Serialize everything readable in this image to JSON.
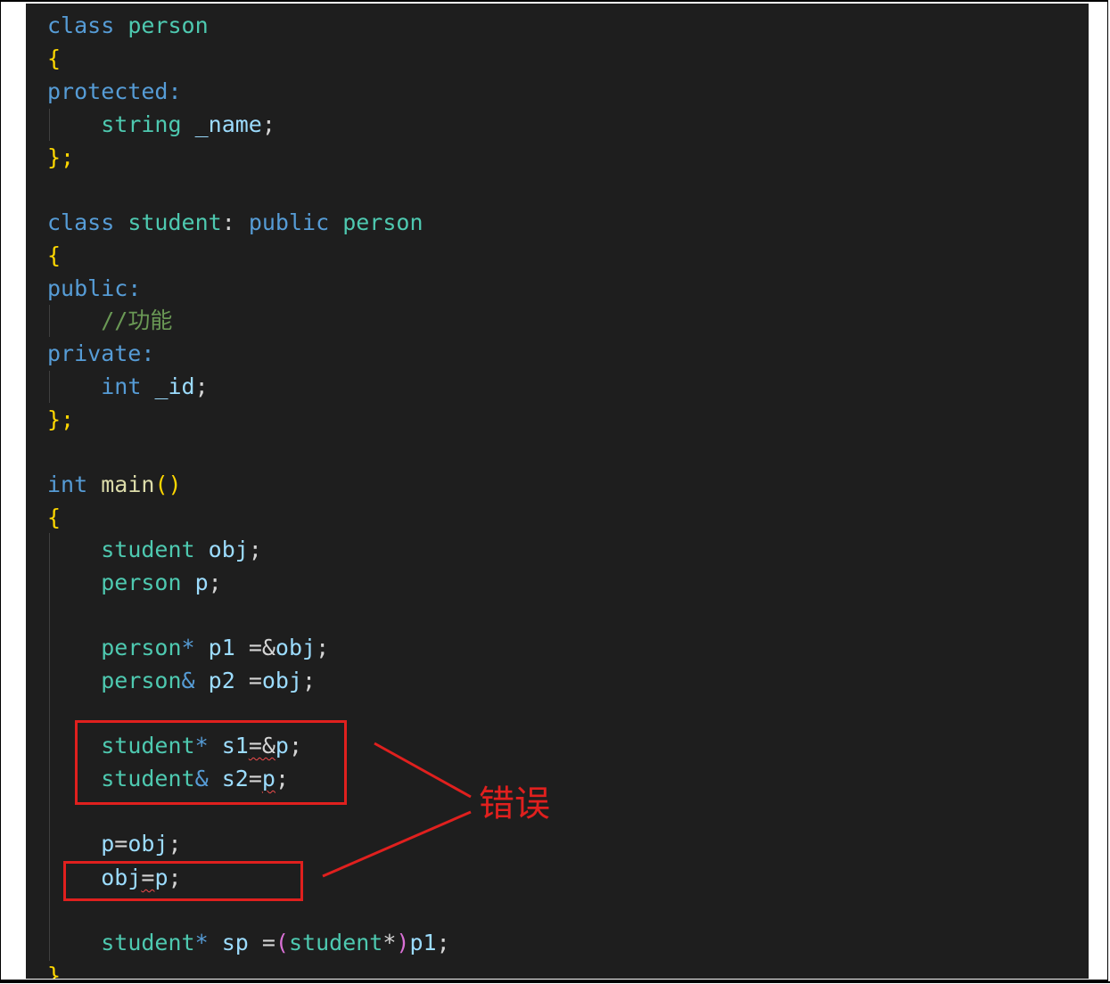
{
  "annotation": {
    "label": "错误",
    "color": "#e0201e"
  },
  "code": {
    "l1_kw": "class",
    "l1_name": "person",
    "l2_brace": "{",
    "l3_access": "protected:",
    "l4_type": "string",
    "l4_id": "_name",
    "l4_semi": ";",
    "l5_end": "};",
    "l7_kw": "class",
    "l7_name": "student",
    "l7_colon": ":",
    "l7_public": "public",
    "l7_base": "person",
    "l8_brace": "{",
    "l9_access": "public:",
    "l10_comment": "//功能",
    "l11_access": "private:",
    "l12_type": "int",
    "l12_id": "_id",
    "l12_semi": ";",
    "l13_end": "};",
    "l15_type": "int",
    "l15_fn": "main",
    "l15_parens": "()",
    "l16_brace": "{",
    "l17_type": "student",
    "l17_id": "obj",
    "l17_semi": ";",
    "l18_type": "person",
    "l18_id": "p",
    "l18_semi": ";",
    "l20_type": "person",
    "l20_ptr": "*",
    "l20_id": "p1",
    "l20_op": " =&",
    "l20_rhs": "obj",
    "l20_semi": ";",
    "l21_type": "person",
    "l21_ref": "&",
    "l21_id": "p2",
    "l21_op": " =",
    "l21_rhs": "obj",
    "l21_semi": ";",
    "l23_type": "student",
    "l23_ptr": "*",
    "l23_id": "s1",
    "l23_op": "=&",
    "l23_rhs": "p",
    "l23_semi": ";",
    "l24_type": "student",
    "l24_ref": "&",
    "l24_id": "s2",
    "l24_op": "=",
    "l24_rhs": "p",
    "l24_semi": ";",
    "l26_lhs": "p",
    "l26_op": "=",
    "l26_rhs": "obj",
    "l26_semi": ";",
    "l27_lhs": "obj",
    "l27_op": "=",
    "l27_rhs": "p",
    "l27_semi": ";",
    "l29_type": "student",
    "l29_ptr": "*",
    "l29_id": "sp",
    "l29_op": " =",
    "l29_lp": "(",
    "l29_cast": "student",
    "l29_cstar": "*",
    "l29_rp": ")",
    "l29_rhs": "p1",
    "l29_semi": ";",
    "l30_end": "}"
  }
}
